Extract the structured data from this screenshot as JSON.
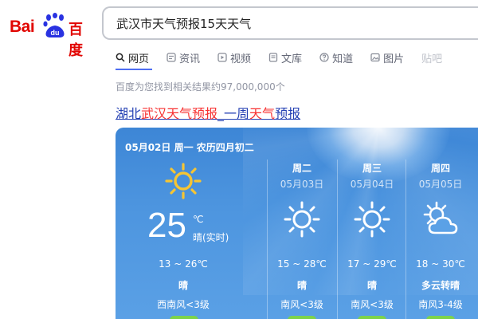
{
  "logo": {
    "bai": "Bai",
    "du": "du",
    "cn": "百度"
  },
  "search": {
    "query": "武汉市天气预报15天天气"
  },
  "tabs": [
    {
      "label": "网页",
      "icon": "search-icon"
    },
    {
      "label": "资讯",
      "icon": "news-icon"
    },
    {
      "label": "视频",
      "icon": "video-icon"
    },
    {
      "label": "文库",
      "icon": "document-icon"
    },
    {
      "label": "知道",
      "icon": "question-icon"
    },
    {
      "label": "图片",
      "icon": "image-icon"
    },
    {
      "label": "贴吧",
      "icon": "tieba-icon"
    }
  ],
  "result_count": "百度为您找到相关结果约97,000,000个",
  "result": {
    "title_parts": [
      "湖北",
      "武汉天气预报",
      "_一周",
      "天气",
      "预报"
    ]
  },
  "weather": {
    "date_line": "05月02日 周一 农历四月初二",
    "today": {
      "temp": "25",
      "unit": "℃",
      "now": "晴(实时)",
      "range": "13 ~ 26℃",
      "cond": "晴",
      "wind": "西南风<3级",
      "icon": "sun-icon"
    },
    "days": [
      {
        "name": "周二",
        "date": "05月03日",
        "range": "15 ~ 28℃",
        "cond": "晴",
        "wind": "南风<3级",
        "icon": "sun-icon"
      },
      {
        "name": "周三",
        "date": "05月04日",
        "range": "17 ~ 29℃",
        "cond": "晴",
        "wind": "南风<3级",
        "icon": "sun-icon"
      },
      {
        "name": "周四",
        "date": "05月05日",
        "range": "18 ~ 30℃",
        "cond": "多云转晴",
        "wind": "南风3-4级",
        "icon": "partly-cloudy-icon"
      }
    ]
  },
  "colors": {
    "brand_red": "#e10602",
    "brand_blue": "#2932e1",
    "link_blue": "#2440b3",
    "highlight_red": "#f73131",
    "sun_yellow": "#f6c533",
    "aqi_green": "#7dd34a"
  }
}
